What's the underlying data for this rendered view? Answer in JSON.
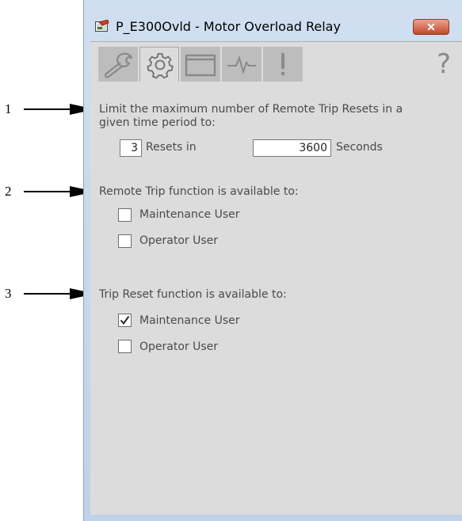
{
  "callouts": [
    "1",
    "2",
    "3"
  ],
  "window": {
    "title": "P_E300Ovld - Motor Overload Relay",
    "close_label": "✕"
  },
  "tabs": [
    {
      "icon": "wrench-icon"
    },
    {
      "icon": "gear-icon",
      "active": true
    },
    {
      "icon": "window-icon"
    },
    {
      "icon": "waveform-icon"
    },
    {
      "icon": "exclamation-icon"
    }
  ],
  "help_label": "?",
  "section1": {
    "line1": "Limit the maximum number of Remote Trip Resets in a",
    "line2": "given time period to:",
    "resets_value": "3",
    "resets_label": "Resets in",
    "seconds_value": "3600",
    "seconds_label": "Seconds"
  },
  "section2": {
    "heading": "Remote Trip function is available to:",
    "options": [
      {
        "label": "Maintenance User",
        "checked": false
      },
      {
        "label": "Operator User",
        "checked": false
      }
    ]
  },
  "section3": {
    "heading": "Trip Reset function is available to:",
    "options": [
      {
        "label": "Maintenance User",
        "checked": true
      },
      {
        "label": "Operator User",
        "checked": false
      }
    ]
  }
}
